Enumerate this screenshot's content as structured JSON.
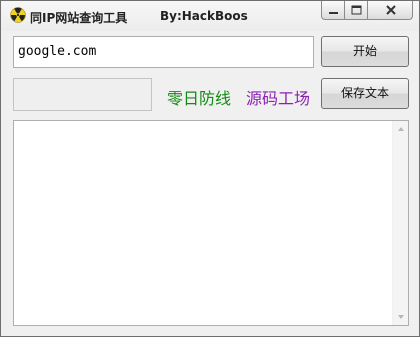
{
  "window": {
    "title": "同IP网站查询工具",
    "author": "By:HackBoos"
  },
  "input": {
    "domain_value": "google.com"
  },
  "buttons": {
    "start_label": "开始",
    "save_label": "保存文本"
  },
  "links": {
    "green_label": "零日防线",
    "purple_label": "源码工场"
  },
  "icons": {
    "app": "radiation-icon",
    "minimize": "minimize-icon",
    "maximize": "maximize-icon",
    "close": "close-icon"
  },
  "colors": {
    "green_link": "#138a13",
    "purple_link": "#8b1fb5"
  }
}
